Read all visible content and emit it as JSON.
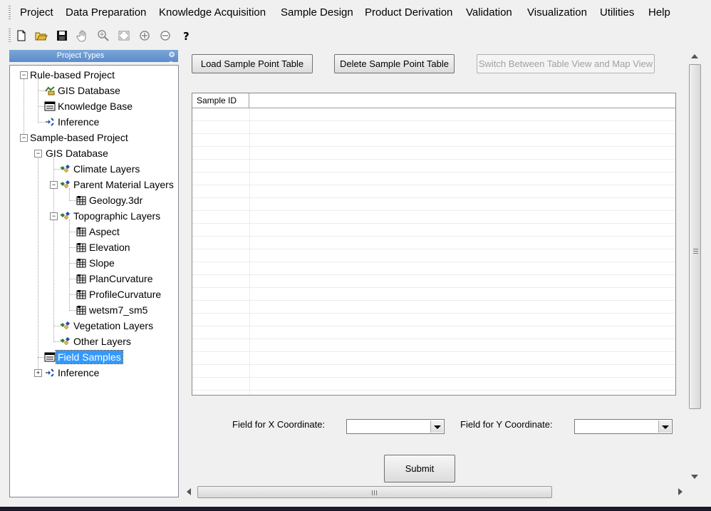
{
  "menu": {
    "items": [
      "Project",
      "Data Preparation",
      "Knowledge Acquisition",
      "Sample Design",
      "Product Derivation",
      "Validation",
      "Visualization",
      "Utilities",
      "Help"
    ]
  },
  "toolbar": {
    "icons": [
      "new-file-icon",
      "open-folder-icon",
      "save-icon",
      "pan-hand-icon",
      "zoom-in-magnifier-icon",
      "full-extent-icon",
      "zoom-in-icon",
      "zoom-out-icon",
      "help-icon"
    ]
  },
  "panel": {
    "title": "Project Types",
    "pin": "❂ ×"
  },
  "tree": {
    "rule_based": "Rule-based Project",
    "rb_gis": "GIS Database",
    "rb_kb": "Knowledge Base",
    "rb_inference": "Inference",
    "sample_based": "Sample-based Project",
    "sb_gis": "GIS Database",
    "climate": "Climate Layers",
    "parent_material": "Parent Material Layers",
    "geology": "Geology.3dr",
    "topographic": "Topographic Layers",
    "aspect": "Aspect",
    "elevation": "Elevation",
    "slope": "Slope",
    "plancurv": "PlanCurvature",
    "profilecurv": "ProfileCurvature",
    "wetsm": "wetsm7_sm5",
    "vegetation": "Vegetation Layers",
    "other": "Other Layers",
    "field_samples": "Field Samples",
    "sb_inference": "Inference"
  },
  "buttons": {
    "load": "Load Sample Point Table",
    "delete": "Delete Sample Point Table",
    "switch": "Switch Between Table View and Map View",
    "submit": "Submit"
  },
  "grid": {
    "col1": "Sample ID"
  },
  "form": {
    "x_label": "Field for X Coordinate:",
    "y_label": "Field for Y Coordinate:",
    "x_value": "",
    "y_value": ""
  },
  "colors": {
    "selection": "#3399ff",
    "panel_title": "#6b98d0"
  }
}
